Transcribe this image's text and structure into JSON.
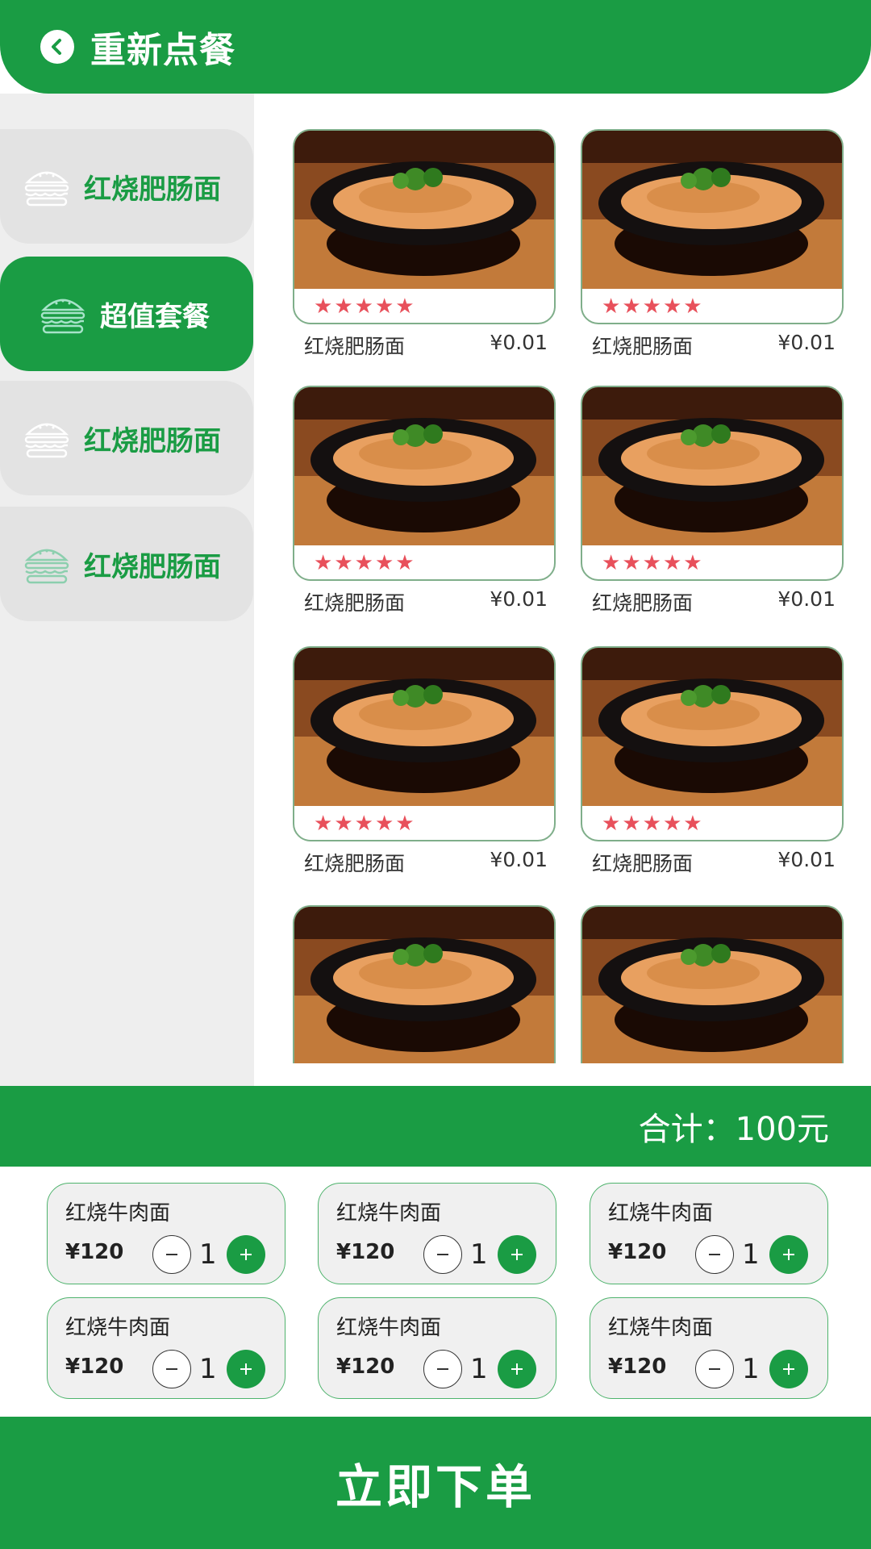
{
  "header": {
    "title": "重新点餐",
    "back_icon": "chevron-left-icon"
  },
  "sidebar": {
    "items": [
      {
        "label": "红烧肥肠面",
        "icon": "burger-icon",
        "active": false
      },
      {
        "label": "超值套餐",
        "icon": "burger-icon",
        "active": true
      },
      {
        "label": "红烧肥肠面",
        "icon": "burger-icon",
        "active": false
      },
      {
        "label": "红烧肥肠面",
        "icon": "burger-icon",
        "active": false
      }
    ]
  },
  "products": [
    {
      "name": "红烧肥肠面",
      "price": "¥0.01",
      "rating": 5
    },
    {
      "name": "红烧肥肠面",
      "price": "¥0.01",
      "rating": 5
    },
    {
      "name": "红烧肥肠面",
      "price": "¥0.01",
      "rating": 5
    },
    {
      "name": "红烧肥肠面",
      "price": "¥0.01",
      "rating": 5
    },
    {
      "name": "红烧肥肠面",
      "price": "¥0.01",
      "rating": 5
    },
    {
      "name": "红烧肥肠面",
      "price": "¥0.01",
      "rating": 5
    },
    {
      "name": "",
      "price": "",
      "rating": 0
    },
    {
      "name": "",
      "price": "",
      "rating": 0
    }
  ],
  "total": {
    "text": "合计：100元"
  },
  "cart": [
    {
      "name": "红烧牛肉面",
      "price": "¥120",
      "qty": "1"
    },
    {
      "name": "红烧牛肉面",
      "price": "¥120",
      "qty": "1"
    },
    {
      "name": "红烧牛肉面",
      "price": "¥120",
      "qty": "1"
    },
    {
      "name": "红烧牛肉面",
      "price": "¥120",
      "qty": "1"
    },
    {
      "name": "红烧牛肉面",
      "price": "¥120",
      "qty": "1"
    },
    {
      "name": "红烧牛肉面",
      "price": "¥120",
      "qty": "1"
    }
  ],
  "order_button": {
    "label": "立即下单"
  },
  "colors": {
    "primary": "#1a9c44",
    "star": "#e8505b",
    "sidebar_bg": "#eeeeee",
    "category_bg": "#e3e3e3"
  }
}
